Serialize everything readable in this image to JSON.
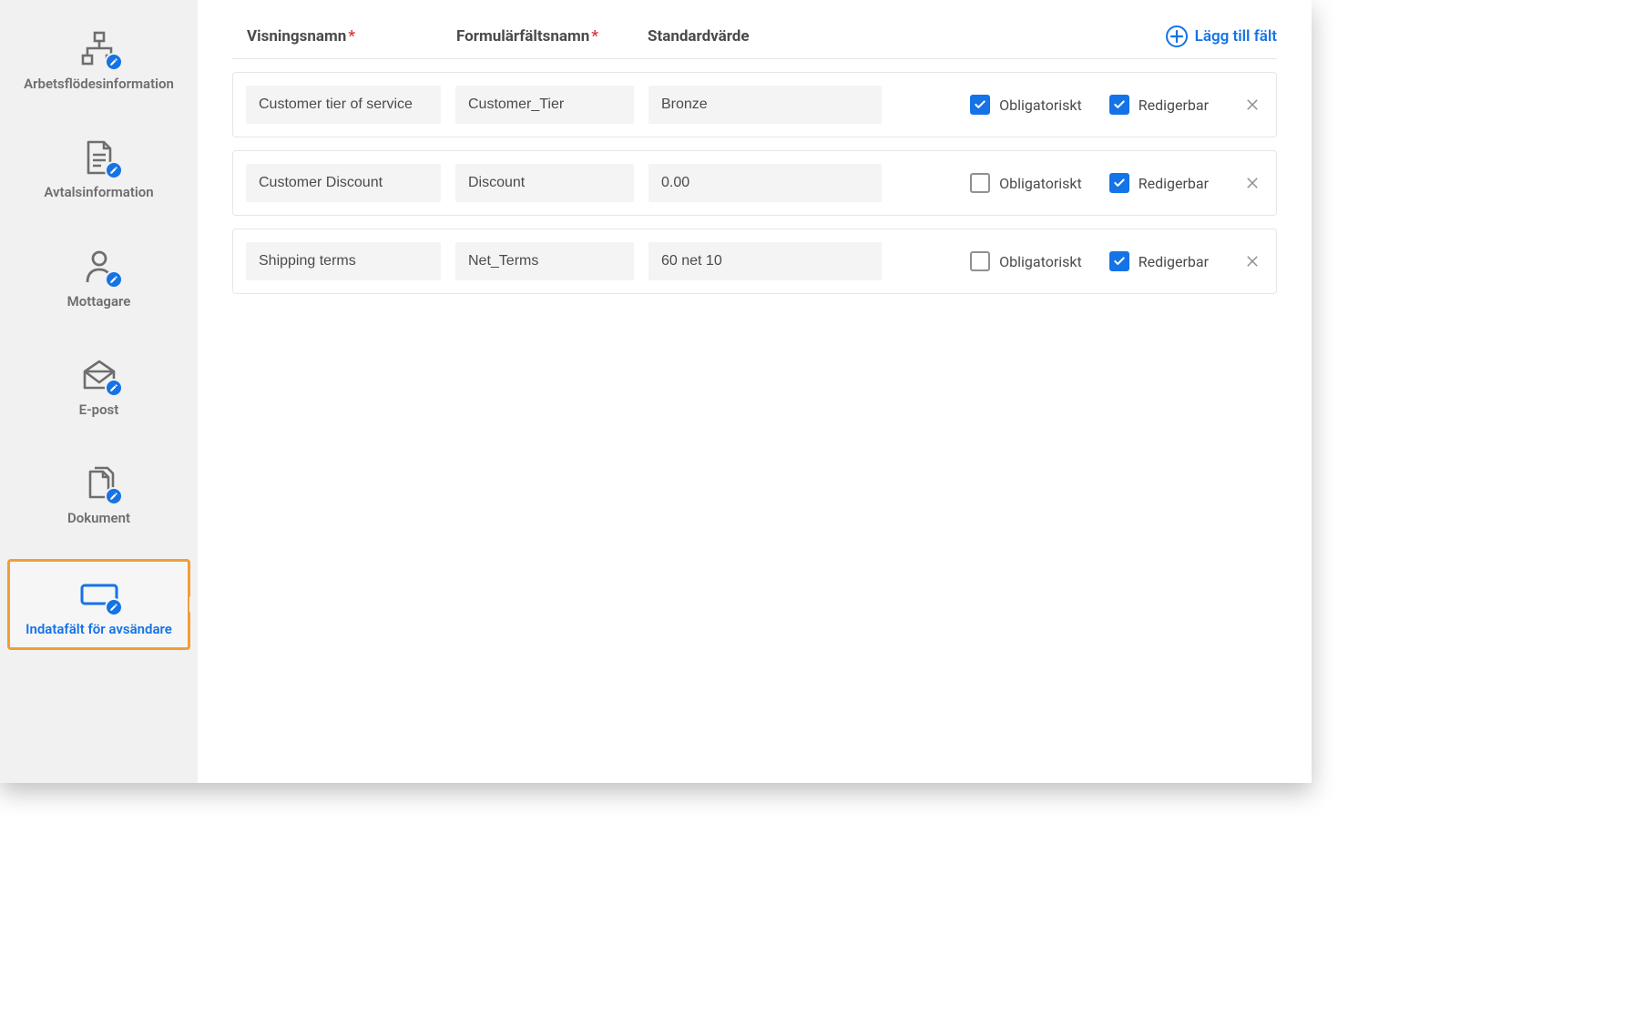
{
  "sidebar": {
    "items": [
      {
        "label": "Arbetsflödesinformation",
        "icon": "workflow"
      },
      {
        "label": "Avtalsinformation",
        "icon": "agreement"
      },
      {
        "label": "Mottagare",
        "icon": "recipient"
      },
      {
        "label": "E-post",
        "icon": "email"
      },
      {
        "label": "Dokument",
        "icon": "document"
      },
      {
        "label": "Indatafält för avsändare",
        "icon": "input-field",
        "active": true
      }
    ]
  },
  "headers": {
    "display_name": "Visningsnamn",
    "form_field_name": "Formulärfältsnamn",
    "default_value": "Standardvärde",
    "required_mark": "*"
  },
  "add_field_label": "Lägg till fält",
  "checkbox_labels": {
    "mandatory": "Obligatoriskt",
    "editable": "Redigerbar"
  },
  "rows": [
    {
      "display_name": "Customer tier of service",
      "form_field": "Customer_Tier",
      "default_value": "Bronze",
      "mandatory": true,
      "editable": true
    },
    {
      "display_name": "Customer Discount",
      "form_field": "Discount",
      "default_value": "0.00",
      "mandatory": false,
      "editable": true
    },
    {
      "display_name": "Shipping terms",
      "form_field": "Net_Terms",
      "default_value": "60 net 10",
      "mandatory": false,
      "editable": true
    }
  ]
}
